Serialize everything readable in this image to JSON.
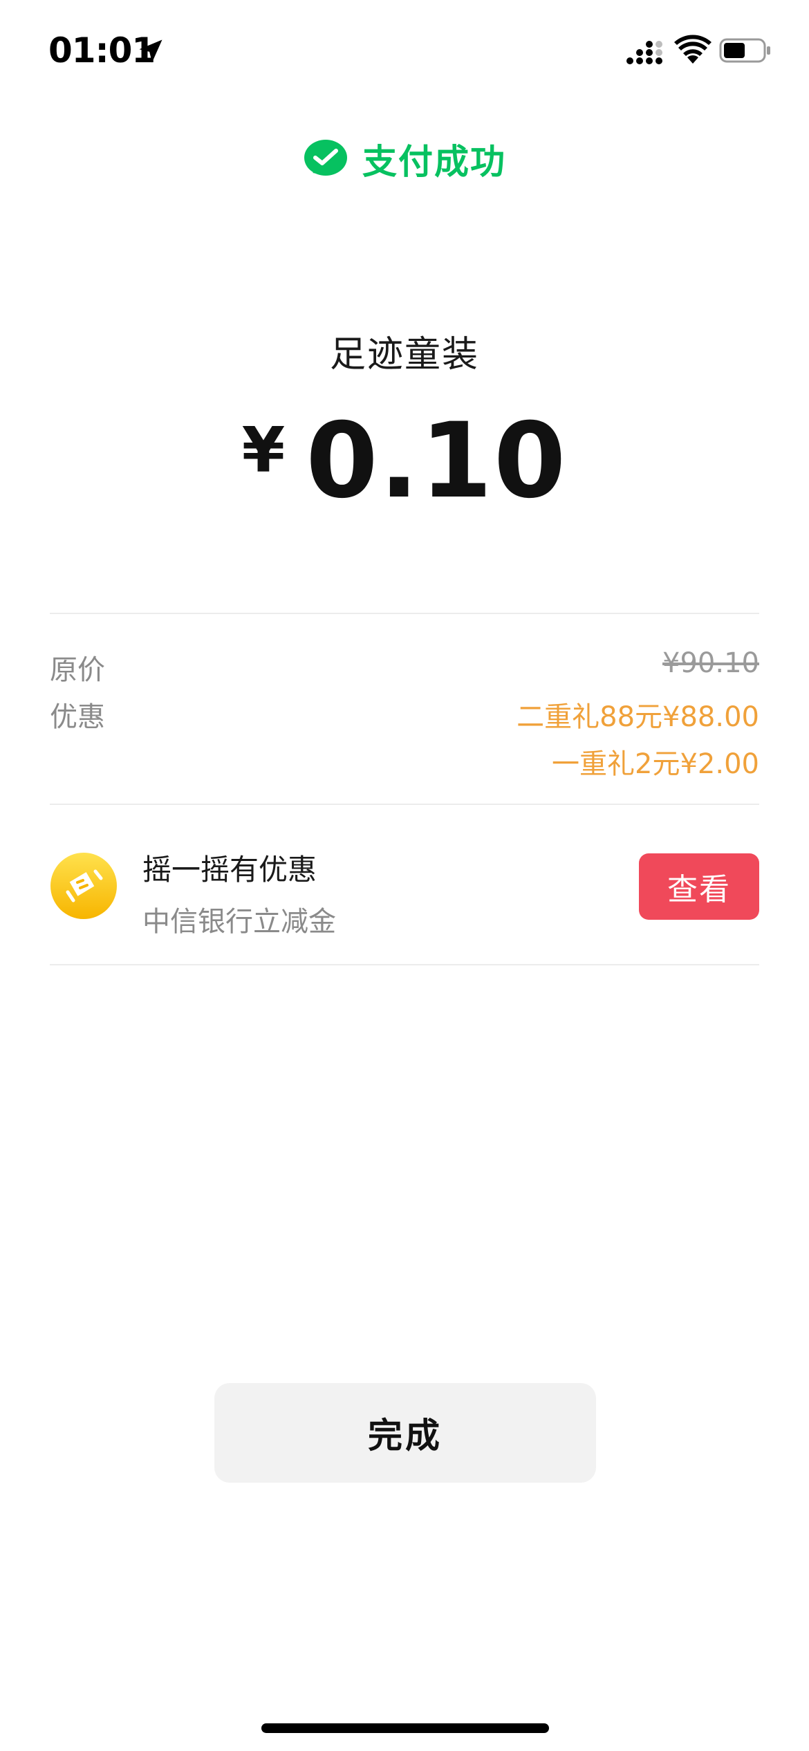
{
  "status_bar": {
    "time": "01:01",
    "location_icon": "location-arrow-icon",
    "signal_icon": "cellular-signal-icon",
    "wifi_icon": "wifi-icon",
    "battery_icon": "battery-icon",
    "battery_level": 0.55
  },
  "header": {
    "icon": "wechat-pay-icon",
    "title": "支付成功",
    "accent_color": "#07c160"
  },
  "payment": {
    "merchant": "足迹童装",
    "currency": "¥",
    "amount": "0.10"
  },
  "details": {
    "original_price_label": "原价",
    "original_price_value": "¥90.10",
    "discount_label": "优惠",
    "discounts": [
      "二重礼88元¥88.00",
      "一重礼2元¥2.00"
    ],
    "discount_color": "#f0a13a"
  },
  "promo": {
    "icon": "shake-coupon-icon",
    "title": "摇一摇有优惠",
    "subtitle": "中信银行立减金",
    "button_label": "查看",
    "button_color": "#f0495a"
  },
  "footer": {
    "done_label": "完成"
  }
}
